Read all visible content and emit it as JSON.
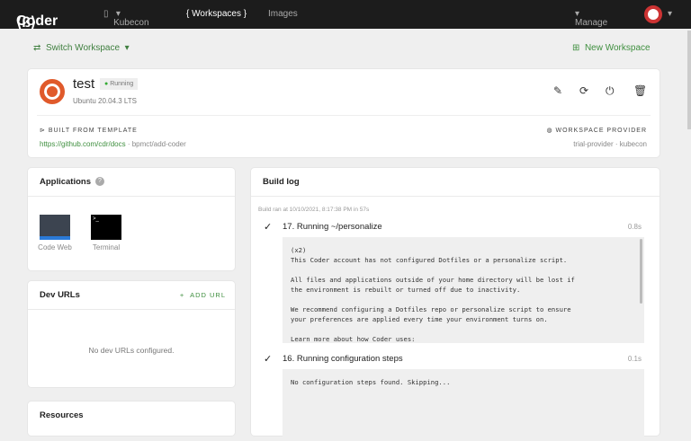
{
  "nav": {
    "brand": "Coder",
    "org": "Kubecon",
    "workspaces": "{ Workspaces }",
    "images": "Images",
    "manage": "Manage"
  },
  "toolbar": {
    "switch": "Switch Workspace",
    "new": "New Workspace"
  },
  "workspace": {
    "name": "test",
    "status": "Running",
    "image": "Ubuntu 20.04.3 LTS",
    "template_label": "BUILT FROM TEMPLATE",
    "template_url": "https://github.com/cdr/docs",
    "template_branch": "· bpmct/add-coder",
    "provider_label": "WORKSPACE PROVIDER",
    "provider": "trial-provider · kubecon"
  },
  "applications": {
    "title": "Applications",
    "apps": [
      {
        "label": "Code Web"
      },
      {
        "label": "Terminal"
      }
    ]
  },
  "devurls": {
    "title": "Dev URLs",
    "add": "ADD URL",
    "empty": "No dev URLs configured."
  },
  "resources": {
    "title": "Resources"
  },
  "buildlog": {
    "title": "Build log",
    "summary": "Build ran at 10/10/2021, 8:17:38 PM in 57s",
    "steps": [
      {
        "title": "17. Running ~/personalize",
        "duration": "0.8s",
        "output": "(x2)\nThis Coder account has not configured Dotfiles or a personalize script.\n\nAll files and applications outside of your home directory will be lost if\nthe environment is rebuilt or turned off due to inactivity.\n\nWe recommend configuring a Dotfiles repo or personalize script to ensure\nyour preferences are applied every time your environment turns on.\n\nLearn more about how Coder uses:"
      },
      {
        "title": "16. Running configuration steps",
        "duration": "0.1s",
        "output": "No configuration steps found. Skipping..."
      }
    ]
  },
  "colors": {
    "accent": "#3f8f3f",
    "nav": "#1c1c1c",
    "ubuntu": "#e05a2b"
  }
}
